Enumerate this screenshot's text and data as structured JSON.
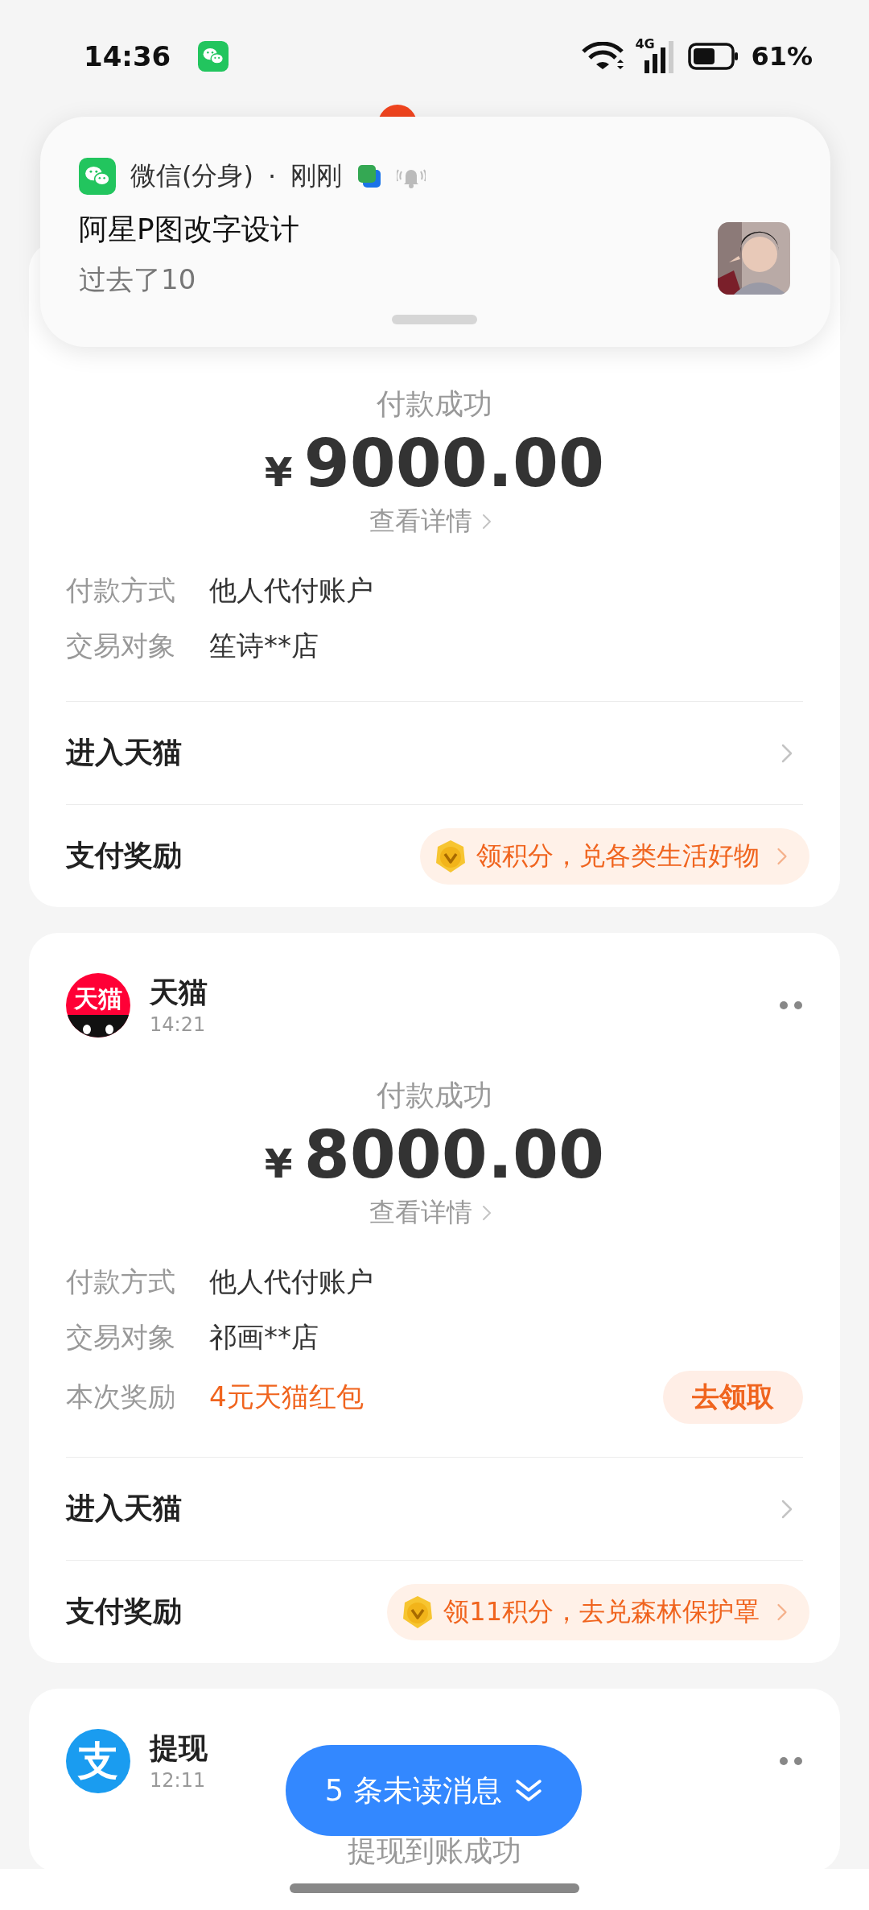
{
  "status_bar": {
    "time": "14:36",
    "network": "4G",
    "battery": "61%"
  },
  "notification": {
    "app": "微信(分身)",
    "separator": "·",
    "time": "刚刚",
    "title": "阿星P图改字设计",
    "body": "过去了10"
  },
  "cards": [
    {
      "status": "付款成功",
      "currency": "¥",
      "amount": "9000.00",
      "details_link": "查看详情",
      "fields": [
        {
          "kind": "text",
          "label": "付款方式",
          "value": "他人代付账户"
        },
        {
          "kind": "text",
          "label": "交易对象",
          "value": "笙诗**店"
        }
      ],
      "links": [
        {
          "kind": "nav",
          "label": "进入天猫"
        },
        {
          "kind": "reward",
          "label": "支付奖励",
          "badge": "领积分，兑各类生活好物"
        }
      ]
    },
    {
      "header": {
        "logo": {
          "kind": "tmall",
          "text": "天猫"
        },
        "name": "天猫",
        "time": "14:21"
      },
      "status": "付款成功",
      "currency": "¥",
      "amount": "8000.00",
      "details_link": "查看详情",
      "fields": [
        {
          "kind": "text",
          "label": "付款方式",
          "value": "他人代付账户"
        },
        {
          "kind": "text",
          "label": "交易对象",
          "value": "祁画**店"
        },
        {
          "kind": "reward",
          "label": "本次奖励",
          "value": "4元天猫红包",
          "action": "去领取"
        }
      ],
      "links": [
        {
          "kind": "nav",
          "label": "进入天猫"
        },
        {
          "kind": "reward",
          "label": "支付奖励",
          "badge": "领11积分，去兑森林保护罩"
        }
      ]
    },
    {
      "header": {
        "logo": {
          "kind": "alipay",
          "text": "支"
        },
        "name": "提现",
        "time": "12:11"
      },
      "status": "提现到账成功"
    }
  ],
  "unread_button": {
    "label": "5 条未读消息"
  }
}
